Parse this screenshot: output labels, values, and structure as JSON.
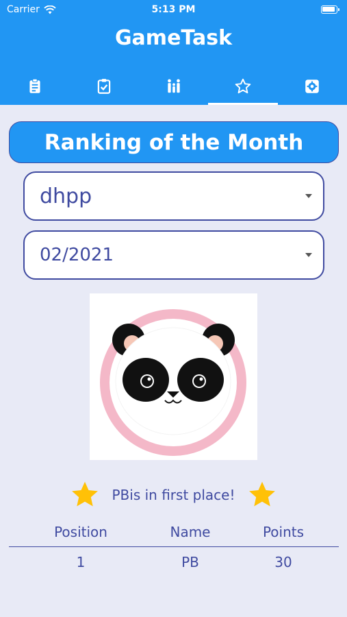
{
  "status": {
    "carrier": "Carrier",
    "time": "5:13 PM"
  },
  "app": {
    "title": "GameTask"
  },
  "tabs": [
    {
      "icon": "clipboard-icon",
      "active": false
    },
    {
      "icon": "checked-clipboard-icon",
      "active": false
    },
    {
      "icon": "family-icon",
      "active": false
    },
    {
      "icon": "star-icon",
      "active": true
    },
    {
      "icon": "gear-icon",
      "active": false
    }
  ],
  "banner": {
    "title": "Ranking of the Month"
  },
  "filters": {
    "user_value": "dhpp",
    "month_value": "02/2021"
  },
  "winner": {
    "message": "PBis in first place!"
  },
  "table": {
    "headers": [
      "Position",
      "Name",
      "Points"
    ],
    "rows": [
      [
        "1",
        "PB",
        "30"
      ]
    ]
  },
  "colors": {
    "primary": "#2196f3",
    "text": "#3f4aa0",
    "background": "#e8eaf6",
    "star": "#ffc107",
    "panda_ring": "#f4b8c8"
  }
}
